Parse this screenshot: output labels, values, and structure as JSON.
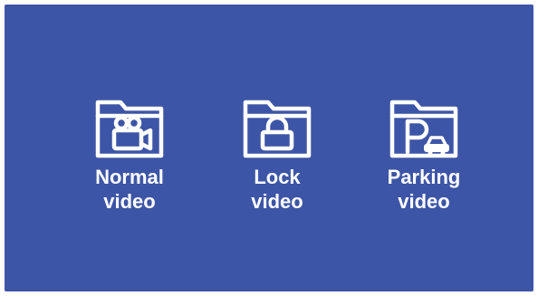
{
  "options": [
    {
      "line1": "Normal",
      "line2": "video",
      "icon": "video-camera-folder-icon"
    },
    {
      "line1": "Lock",
      "line2": "video",
      "icon": "padlock-folder-icon"
    },
    {
      "line1": "Parking",
      "line2": "video",
      "icon": "parking-car-folder-icon"
    }
  ],
  "colors": {
    "background": "#3d55a6",
    "foreground": "#ffffff"
  }
}
